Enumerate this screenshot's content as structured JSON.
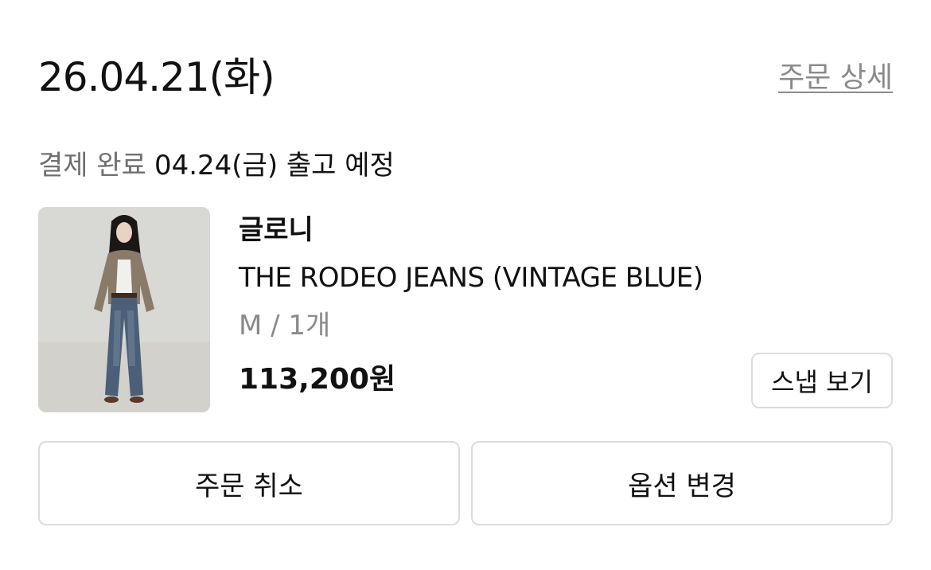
{
  "order": {
    "date": "26.04.21(화)",
    "detail_link": "주문 상세",
    "status": "결제 완료",
    "shipping": "04.24(금) 출고 예정"
  },
  "product": {
    "image": "product-photo",
    "brand": "글로니",
    "name": "THE RODEO JEANS (VINTAGE BLUE)",
    "option": "M / 1개",
    "price": "113,200원",
    "snap_button": "스냅 보기"
  },
  "actions": {
    "cancel_label": "주문 취소",
    "change_option_label": "옵션 변경"
  }
}
